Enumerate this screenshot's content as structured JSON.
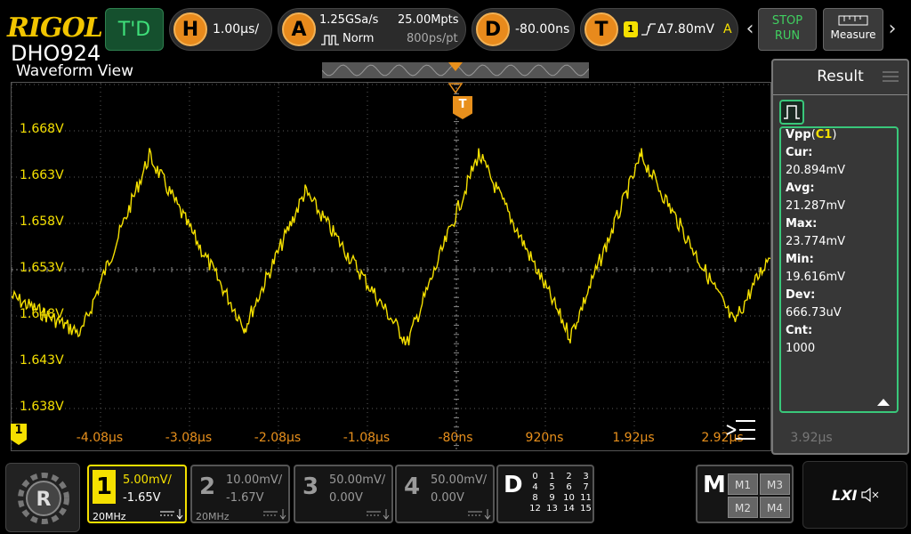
{
  "brand": {
    "name": "RIGOL",
    "model": "DHO924"
  },
  "toolbar": {
    "td_label": "T'D",
    "horizontal": {
      "badge": "H",
      "timebase": "1.00μs/"
    },
    "acquire": {
      "badge": "A",
      "sample_rate": "1.25GSa/s",
      "mode": "Norm",
      "memory_depth": "25.00Mpts",
      "points_per_div": "800ps/pt"
    },
    "delay": {
      "badge": "D",
      "value": "-80.00ns"
    },
    "trigger": {
      "badge": "T",
      "source": "1",
      "level": "Δ7.80mV",
      "sweep": "A"
    },
    "stop_label": "STOP",
    "run_label": "RUN",
    "measure_label": "Measure"
  },
  "waveform_view": {
    "title": "Waveform View",
    "trigger_marker": "T",
    "channel_marker": "1",
    "y_labels": [
      "1.668V",
      "1.663V",
      "1.658V",
      "1.653V",
      "1.648V",
      "1.643V",
      "1.638V"
    ],
    "x_labels": [
      "-4.08μs",
      "-3.08μs",
      "-2.08μs",
      "-1.08μs",
      "-80ns",
      "920ns",
      "1.92μs",
      "2.92μs",
      "3.92μs"
    ]
  },
  "result": {
    "title": "Result",
    "measurement": {
      "name": "Vpp",
      "channel": "C1",
      "cur_label": "Cur:",
      "cur": "20.894mV",
      "avg_label": "Avg:",
      "avg": "21.287mV",
      "max_label": "Max:",
      "max": "23.774mV",
      "min_label": "Min:",
      "min": "19.616mV",
      "dev_label": "Dev:",
      "dev": "666.73uV",
      "cnt_label": "Cnt:",
      "cnt": "1000"
    }
  },
  "channels": [
    {
      "num": "1",
      "scale": "5.00mV/",
      "offset": "-1.65V",
      "bw": "20MHz",
      "color": "#f5e000",
      "active": true
    },
    {
      "num": "2",
      "scale": "10.00mV/",
      "offset": "-1.67V",
      "bw": "20MHz",
      "color": "#9a9a9a",
      "active": false
    },
    {
      "num": "3",
      "scale": "50.00mV/",
      "offset": "0.00V",
      "bw": "",
      "color": "#9a9a9a",
      "active": false
    },
    {
      "num": "4",
      "scale": "50.00mV/",
      "offset": "0.00V",
      "bw": "",
      "color": "#9a9a9a",
      "active": false
    }
  ],
  "digital": {
    "label": "D",
    "channels": [
      "0",
      "1",
      "2",
      "3",
      "4",
      "5",
      "6",
      "7",
      "8",
      "9",
      "10",
      "11",
      "12",
      "13",
      "14",
      "15"
    ]
  },
  "math": {
    "label": "M",
    "buttons": [
      "M1",
      "M3",
      "M2",
      "M4"
    ]
  },
  "lxi_label": "LXI",
  "colors": {
    "ch1": "#f5e000",
    "accent": "#e8901c",
    "grid": "#5a5a5a",
    "run": "#40d060",
    "card": "#39c77a"
  }
}
